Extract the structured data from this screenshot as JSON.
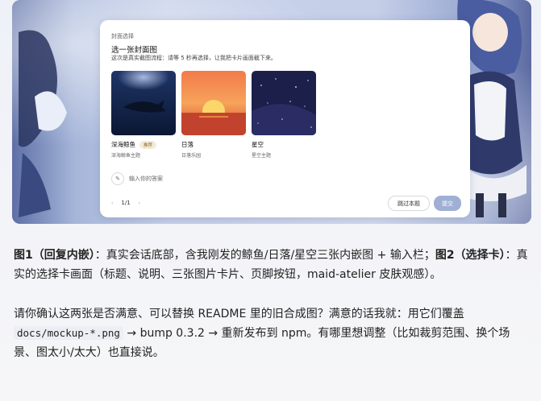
{
  "card": {
    "kicker": "封面选择",
    "title": "选一张封面图",
    "description": "这次是真实截图流程：请等 5 秒再选择，让我把卡片画面截下来。",
    "options": [
      {
        "name": "深海鲸鱼",
        "badge": "推荐",
        "subtitle": "深海鲸鱼主题"
      },
      {
        "name": "日落",
        "subtitle": "日落乐园"
      },
      {
        "name": "星空",
        "subtitle": "星空主题"
      }
    ],
    "answer_placeholder": "输入你的答案",
    "pager": {
      "prev": "‹",
      "page": "1/1",
      "next": "›"
    },
    "skip_label": "跳过本题",
    "submit_label": "提交"
  },
  "caption": {
    "fig1_label": "图1（回复内嵌）",
    "fig1_text": "：真实会话底部，含我刚发的鲸鱼/日落/星空三张内嵌图 + 输入栏；",
    "fig2_label": "图2（选择卡）",
    "fig2_text": "：真实的选择卡画面（标题、说明、三张图片卡片、页脚按钮，maid-atelier 皮肤观感）。"
  },
  "paragraph": {
    "part1": "请你确认这两张是否满意、可以替换 README 里的旧合成图？满意的话我就：用它们覆盖 ",
    "code": "docs/mockup-*.png",
    "part2": " → bump 0.3.2 → 重新发布到 npm。有哪里想调整（比如裁剪范围、换个场景、图太小/太大）也直接说。"
  },
  "colors": {
    "submit_button": "#9fb0d4",
    "background": "#eef1f7"
  }
}
